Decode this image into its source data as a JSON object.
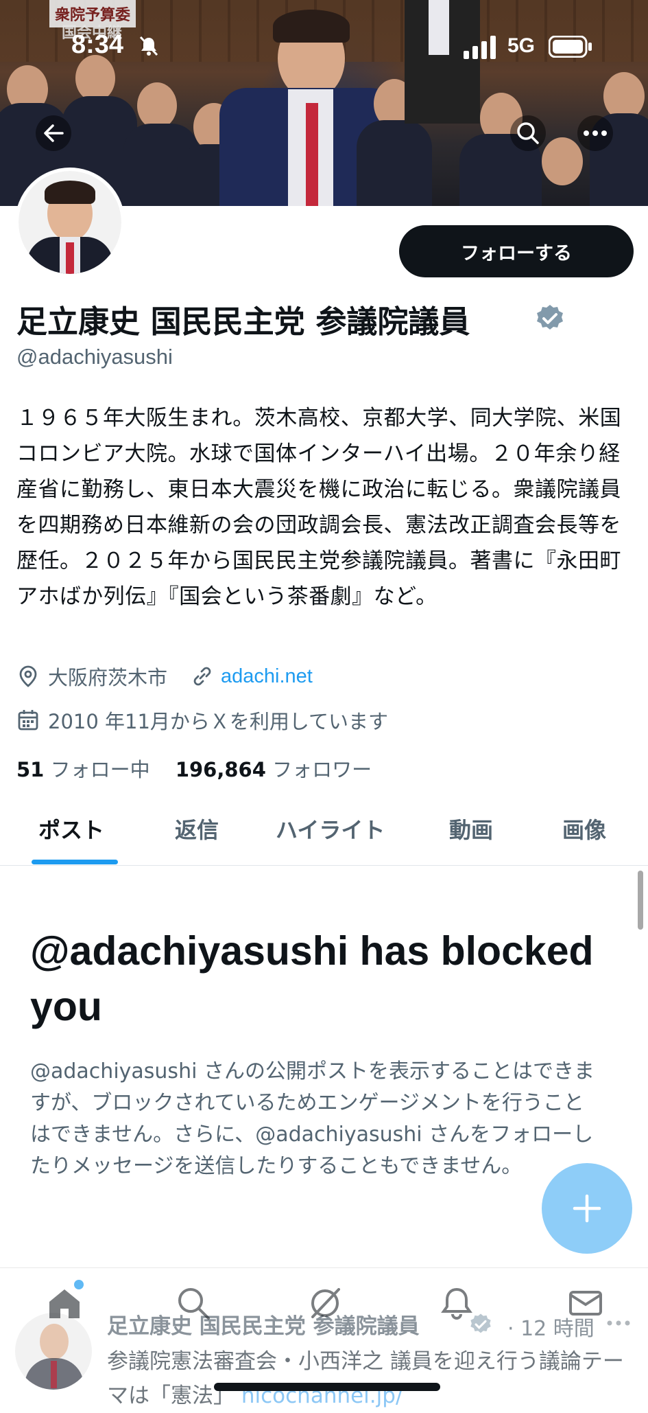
{
  "status_bar": {
    "time": "8:34",
    "network": "5G"
  },
  "banner": {
    "sign_line1": "衆院予算委",
    "sign_line2": "国会中継"
  },
  "profile": {
    "follow_label": "フォローする",
    "display_name": "足立康史 国民民主党 参議院議員",
    "handle": "@adachiyasushi",
    "bio": "１９６５年大阪生まれ。茨木高校、京都大学、同大学院、米国コロンビア大院。水球で国体インターハイ出場。２０年余り経産省に勤務し、東日本大震災を機に政治に転じる。衆議院議員を四期務め日本維新の会の団政調会長、憲法改正調査会長等を歴任。２０２５年から国民民主党参議院議員。著書に『永田町アホばか列伝』『国会という茶番劇』など。",
    "location": "大阪府茨木市",
    "website": "adachi.net",
    "joined": "2010 年11月からＸを利用しています",
    "following_count": "51",
    "following_label": "フォロー中",
    "followers_count": "196,864",
    "followers_label": "フォロワー"
  },
  "tabs": [
    {
      "label": "ポスト",
      "active": true
    },
    {
      "label": "返信",
      "active": false
    },
    {
      "label": "ハイライト",
      "active": false
    },
    {
      "label": "動画",
      "active": false
    },
    {
      "label": "画像",
      "active": false
    }
  ],
  "blocked": {
    "title": "@adachiyasushi has blocked you",
    "body": "@adachiyasushi さんの公開ポストを表示することはできますが、ブロックされているためエンゲージメントを行うことはできません。さらに、@adachiyasushi さんをフォローしたりメッセージを送信したりすることもできません。"
  },
  "fab": {
    "label": "+"
  },
  "tweet_preview": {
    "author": "足立康史 国民民主党 参議院議員",
    "time": "· 12 時間",
    "text_prefix": "参議院憲法審査会・小西洋之 議員を迎え行う議論テーマは「憲法」",
    "link": "nicochannel.jp/"
  },
  "icons": {
    "back": "back-arrow-icon",
    "search": "search-icon",
    "more": "more-icon",
    "location": "location-pin-icon",
    "link": "link-icon",
    "calendar": "calendar-icon",
    "verified": "verified-badge-icon"
  },
  "colors": {
    "accent": "#1d9bf0",
    "text_primary": "#0f1419",
    "text_secondary": "#536471",
    "fab": "#8ecdf8",
    "follow_button": "#0f1419",
    "verified_badge": "#829aab"
  }
}
